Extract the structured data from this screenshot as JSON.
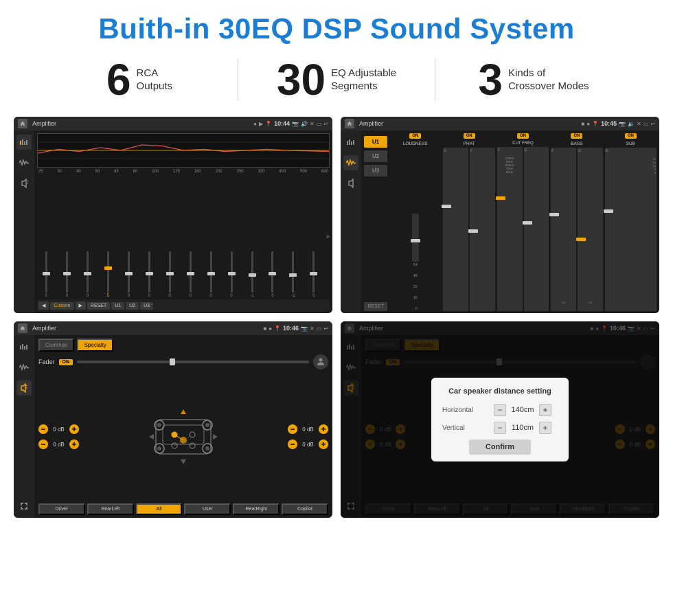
{
  "page": {
    "title": "Buith-in 30EQ DSP Sound System",
    "features": [
      {
        "number": "6",
        "text_line1": "RCA",
        "text_line2": "Outputs"
      },
      {
        "number": "30",
        "text_line1": "EQ Adjustable",
        "text_line2": "Segments"
      },
      {
        "number": "3",
        "text_line1": "Kinds of",
        "text_line2": "Crossover Modes"
      }
    ]
  },
  "screen1": {
    "title": "Amplifier",
    "time": "10:44",
    "mode": "Custom",
    "freq_labels": [
      "25",
      "32",
      "40",
      "50",
      "63",
      "80",
      "100",
      "125",
      "160",
      "200",
      "250",
      "320",
      "400",
      "500",
      "630"
    ],
    "slider_values": [
      "0",
      "0",
      "0",
      "5",
      "0",
      "0",
      "0",
      "0",
      "0",
      "0",
      "0",
      "-1",
      "0",
      "-1"
    ],
    "buttons": [
      "Custom",
      "RESET",
      "U1",
      "U2",
      "U3"
    ]
  },
  "screen2": {
    "title": "Amplifier",
    "time": "10:45",
    "presets": [
      "U1",
      "U2",
      "U3"
    ],
    "channels": [
      {
        "on": true,
        "label": "LOUDNESS"
      },
      {
        "on": true,
        "label": "PHAT"
      },
      {
        "on": true,
        "label": "CUT FREQ"
      },
      {
        "on": true,
        "label": "BASS"
      },
      {
        "on": true,
        "label": "SUB"
      }
    ],
    "reset_label": "RESET"
  },
  "screen3": {
    "title": "Amplifier",
    "time": "10:46",
    "tabs": [
      "Common",
      "Specialty"
    ],
    "active_tab": "Specialty",
    "fader_label": "Fader",
    "fader_on": "ON",
    "db_controls": [
      {
        "value": "0 dB"
      },
      {
        "value": "0 dB"
      },
      {
        "value": "0 dB"
      },
      {
        "value": "0 dB"
      }
    ],
    "bottom_buttons": [
      "Driver",
      "",
      "All",
      "",
      "User",
      "RearRight"
    ],
    "buttons_full": [
      "Driver",
      "RearLeft",
      "All",
      "User",
      "RearRight",
      "Copilot"
    ]
  },
  "screen4": {
    "title": "Amplifier",
    "time": "10:46",
    "tabs": [
      "Common",
      "Specialty"
    ],
    "dialog": {
      "title": "Car speaker distance setting",
      "horizontal_label": "Horizontal",
      "horizontal_value": "140cm",
      "vertical_label": "Vertical",
      "vertical_value": "110cm",
      "confirm_label": "Confirm"
    },
    "db_right_1": "0 dB",
    "db_right_2": "0 dB",
    "buttons": [
      "Driver",
      "RearLeft",
      "All",
      "User",
      "RearRight",
      "Copilot"
    ]
  }
}
